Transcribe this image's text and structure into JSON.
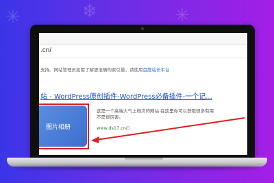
{
  "browser": {
    "url_fragment": ".cn/"
  },
  "notice": {
    "text": "支持。网站管理员如需了解更准确的索引量，请使用",
    "link": "百度站长平台"
  },
  "search_result": {
    "title": "站 - WordPress原创插件-WordPress必备插件-一个记...",
    "thumbnail_label": "图片相册",
    "description_line1": "这是一个高端大气上档次的网站 在这里你可以获取很多有用",
    "description_line2": "不是很厉害。",
    "site_url": "www.ds17.cn/"
  },
  "colors": {
    "background_start": "#3b35e8",
    "background_end": "#a41ee6",
    "link": "#1a4fc9",
    "annotation": "#e01f1f",
    "thumbnail": "#4a7fd8"
  }
}
